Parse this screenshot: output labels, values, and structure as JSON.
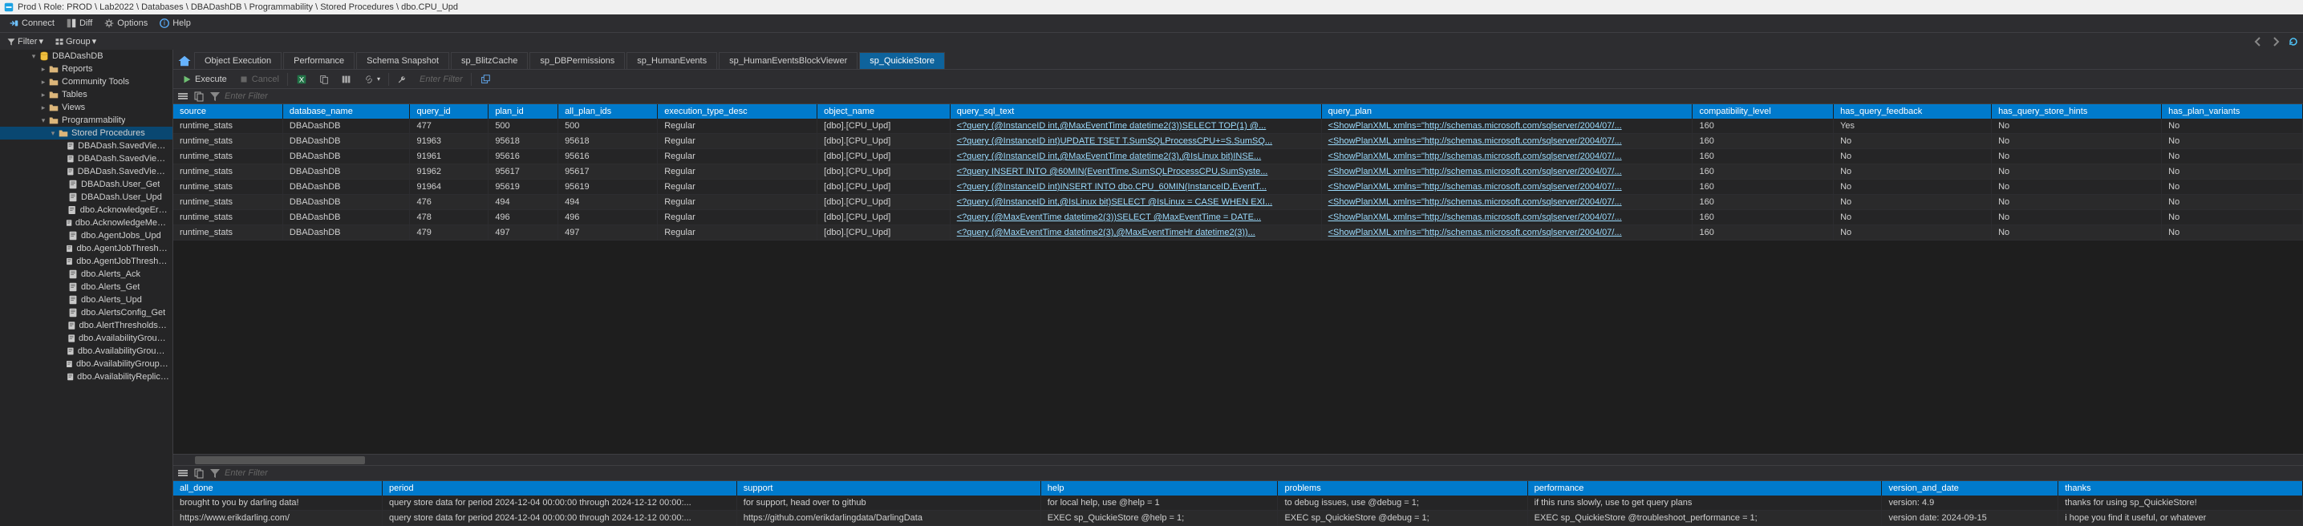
{
  "title": "Prod \\ Role: PROD \\ Lab2022 \\ Databases \\ DBADashDB \\ Programmability \\ Stored Procedures \\ dbo.CPU_Upd",
  "menu": {
    "connect": "Connect",
    "diff": "Diff",
    "options": "Options",
    "help": "Help"
  },
  "filterbar": {
    "filter": "Filter",
    "group": "Group"
  },
  "tree": [
    {
      "d": 3,
      "t": "db",
      "label": "DBADashDB",
      "open": true
    },
    {
      "d": 4,
      "t": "folder",
      "label": "Reports"
    },
    {
      "d": 4,
      "t": "folder",
      "label": "Community Tools"
    },
    {
      "d": 4,
      "t": "folder",
      "label": "Tables"
    },
    {
      "d": 4,
      "t": "folder",
      "label": "Views"
    },
    {
      "d": 4,
      "t": "folder",
      "label": "Programmability",
      "open": true
    },
    {
      "d": 5,
      "t": "folder",
      "label": "Stored Procedures",
      "open": true,
      "sel": true
    },
    {
      "d": 6,
      "t": "sp",
      "label": "DBADash.SavedViews_Del"
    },
    {
      "d": 6,
      "t": "sp",
      "label": "DBADash.SavedViews_Get"
    },
    {
      "d": 6,
      "t": "sp",
      "label": "DBADash.SavedViews_Upd"
    },
    {
      "d": 6,
      "t": "sp",
      "label": "DBADash.User_Get"
    },
    {
      "d": 6,
      "t": "sp",
      "label": "DBADash.User_Upd"
    },
    {
      "d": 6,
      "t": "sp",
      "label": "dbo.AcknowledgeErrors"
    },
    {
      "d": 6,
      "t": "sp",
      "label": "dbo.AcknowledgeMemoryDumps"
    },
    {
      "d": 6,
      "t": "sp",
      "label": "dbo.AgentJobs_Upd"
    },
    {
      "d": 6,
      "t": "sp",
      "label": "dbo.AgentJobThresholds_Get"
    },
    {
      "d": 6,
      "t": "sp",
      "label": "dbo.AgentJobThresholds_Upd"
    },
    {
      "d": 6,
      "t": "sp",
      "label": "dbo.Alerts_Ack"
    },
    {
      "d": 6,
      "t": "sp",
      "label": "dbo.Alerts_Get"
    },
    {
      "d": 6,
      "t": "sp",
      "label": "dbo.Alerts_Upd"
    },
    {
      "d": 6,
      "t": "sp",
      "label": "dbo.AlertsConfig_Get"
    },
    {
      "d": 6,
      "t": "sp",
      "label": "dbo.AlertThresholds_Upd"
    },
    {
      "d": 6,
      "t": "sp",
      "label": "dbo.AvailabilityGroup_Get"
    },
    {
      "d": 6,
      "t": "sp",
      "label": "dbo.AvailabilityGroups_Upd"
    },
    {
      "d": 6,
      "t": "sp",
      "label": "dbo.AvailabilityGroupSummary"
    },
    {
      "d": 6,
      "t": "sp",
      "label": "dbo.AvailabilityReplicas_Upd"
    }
  ],
  "tabs": {
    "items": [
      "Object Execution",
      "Performance",
      "Schema Snapshot",
      "sp_BlitzCache",
      "sp_DBPermissions",
      "sp_HumanEvents",
      "sp_HumanEventsBlockViewer",
      "sp_QuickieStore"
    ],
    "active": 7
  },
  "toolbar": {
    "execute": "Execute",
    "cancel": "Cancel",
    "filter_hint": "Enter Filter"
  },
  "grid1": {
    "filter_hint": "Enter Filter",
    "cols": [
      "source",
      "database_name",
      "query_id",
      "plan_id",
      "all_plan_ids",
      "execution_type_desc",
      "object_name",
      "query_sql_text",
      "query_plan",
      "compatibility_level",
      "has_query_feedback",
      "has_query_store_hints",
      "has_plan_variants"
    ],
    "rows": [
      [
        "runtime_stats",
        "DBADashDB",
        "477",
        "500",
        "500",
        "Regular",
        "[dbo].[CPU_Upd]",
        "<?query (@InstanceID int,@MaxEventTime datetime2(3))SELECT TOP(1) @...",
        "<ShowPlanXML xmlns=\"http://schemas.microsoft.com/sqlserver/2004/07/...",
        "160",
        "Yes",
        "No",
        "No"
      ],
      [
        "runtime_stats",
        "DBADashDB",
        "91963",
        "95618",
        "95618",
        "Regular",
        "[dbo].[CPU_Upd]",
        "<?query (@InstanceID int)UPDATE TSET T.SumSQLProcessCPU+=S.SumSQ...",
        "<ShowPlanXML xmlns=\"http://schemas.microsoft.com/sqlserver/2004/07/...",
        "160",
        "No",
        "No",
        "No"
      ],
      [
        "runtime_stats",
        "DBADashDB",
        "91961",
        "95616",
        "95616",
        "Regular",
        "[dbo].[CPU_Upd]",
        "<?query (@InstanceID int,@MaxEventTime datetime2(3),@IsLinux bit)INSE...",
        "<ShowPlanXML xmlns=\"http://schemas.microsoft.com/sqlserver/2004/07/...",
        "160",
        "No",
        "No",
        "No"
      ],
      [
        "runtime_stats",
        "DBADashDB",
        "91962",
        "95617",
        "95617",
        "Regular",
        "[dbo].[CPU_Upd]",
        "<?query INSERT INTO @60MIN(EventTime,SumSQLProcessCPU,SumSyste...",
        "<ShowPlanXML xmlns=\"http://schemas.microsoft.com/sqlserver/2004/07/...",
        "160",
        "No",
        "No",
        "No"
      ],
      [
        "runtime_stats",
        "DBADashDB",
        "91964",
        "95619",
        "95619",
        "Regular",
        "[dbo].[CPU_Upd]",
        "<?query (@InstanceID int)INSERT INTO dbo.CPU_60MIN(InstanceID,EventT...",
        "<ShowPlanXML xmlns=\"http://schemas.microsoft.com/sqlserver/2004/07/...",
        "160",
        "No",
        "No",
        "No"
      ],
      [
        "runtime_stats",
        "DBADashDB",
        "476",
        "494",
        "494",
        "Regular",
        "[dbo].[CPU_Upd]",
        "<?query (@InstanceID int,@IsLinux bit)SELECT @IsLinux = CASE WHEN EXI...",
        "<ShowPlanXML xmlns=\"http://schemas.microsoft.com/sqlserver/2004/07/...",
        "160",
        "No",
        "No",
        "No"
      ],
      [
        "runtime_stats",
        "DBADashDB",
        "478",
        "496",
        "496",
        "Regular",
        "[dbo].[CPU_Upd]",
        "<?query (@MaxEventTime datetime2(3))SELECT @MaxEventTime = DATE...",
        "<ShowPlanXML xmlns=\"http://schemas.microsoft.com/sqlserver/2004/07/...",
        "160",
        "No",
        "No",
        "No"
      ],
      [
        "runtime_stats",
        "DBADashDB",
        "479",
        "497",
        "497",
        "Regular",
        "[dbo].[CPU_Upd]",
        "<?query (@MaxEventTime datetime2(3),@MaxEventTimeHr datetime2(3))...",
        "<ShowPlanXML xmlns=\"http://schemas.microsoft.com/sqlserver/2004/07/...",
        "160",
        "No",
        "No",
        "No"
      ]
    ],
    "link_cols": [
      7,
      8
    ]
  },
  "grid2": {
    "filter_hint": "Enter Filter",
    "cols": [
      "all_done",
      "period",
      "support",
      "help",
      "problems",
      "performance",
      "version_and_date",
      "thanks"
    ],
    "rows": [
      [
        "brought to you by darling data!",
        "query store data for period 2024-12-04 00:00:00 through 2024-12-12 00:00:...",
        "for support, head over to github",
        "for local help, use @help = 1",
        "to debug issues, use @debug = 1;",
        "if this runs slowly, use to get query plans",
        "version: 4.9",
        "thanks for using sp_QuickieStore!"
      ],
      [
        "https://www.erikdarling.com/",
        "query store data for period 2024-12-04 00:00:00 through 2024-12-12 00:00:...",
        "https://github.com/erikdarlingdata/DarlingData",
        "EXEC sp_QuickieStore @help = 1;",
        "EXEC sp_QuickieStore @debug = 1;",
        "EXEC sp_QuickieStore @troubleshoot_performance = 1;",
        "version date: 2024-09-15",
        "i hope you find it useful, or whatever"
      ]
    ]
  }
}
